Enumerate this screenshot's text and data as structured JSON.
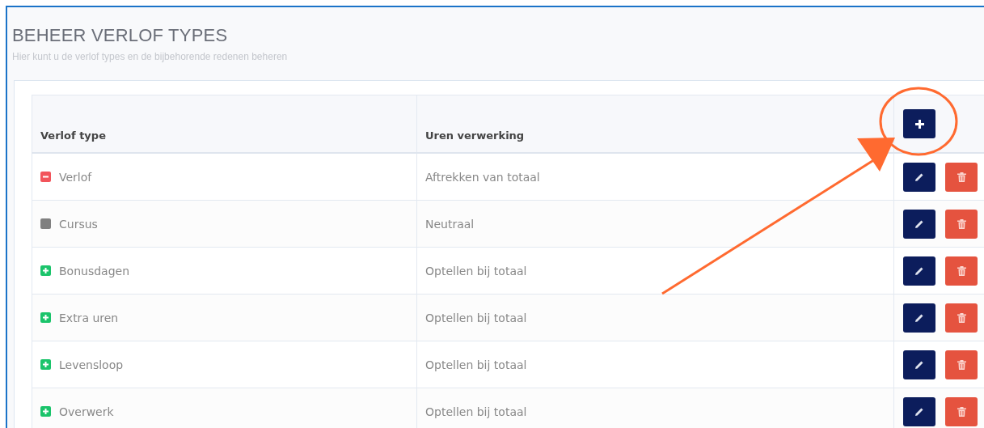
{
  "page": {
    "title": "BEHEER VERLOF TYPES",
    "subtitle": "Hier kunt u de verlof types en de bijbehorende redenen beheren"
  },
  "table": {
    "columns": [
      "Verlof type",
      "Uren verwerking"
    ],
    "rows": [
      {
        "kind": "minus",
        "type": "Verlof",
        "processing": "Aftrekken van totaal"
      },
      {
        "kind": "neutral",
        "type": "Cursus",
        "processing": "Neutraal"
      },
      {
        "kind": "plus",
        "type": "Bonusdagen",
        "processing": "Optellen bij totaal"
      },
      {
        "kind": "plus",
        "type": "Extra uren",
        "processing": "Optellen bij totaal"
      },
      {
        "kind": "plus",
        "type": "Levensloop",
        "processing": "Optellen bij totaal"
      },
      {
        "kind": "plus",
        "type": "Overwerk",
        "processing": "Optellen bij totaal"
      }
    ]
  }
}
